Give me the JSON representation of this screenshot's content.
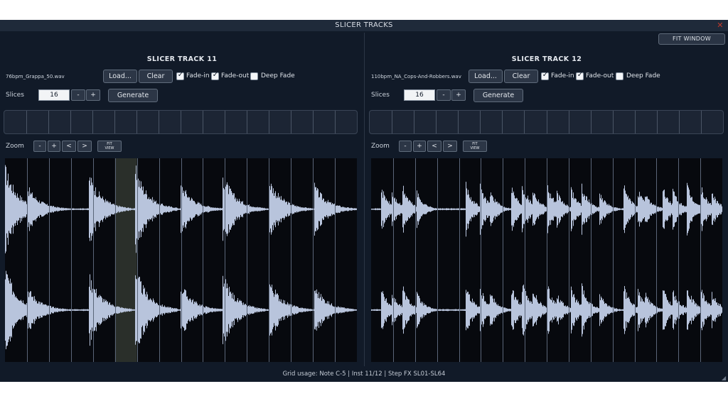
{
  "window": {
    "title": "SLICER TRACKS",
    "close_icon": "close-icon"
  },
  "toolbar": {
    "fit_window_label": "FIT WINDOW"
  },
  "tracks": [
    {
      "title": "SLICER TRACK 11",
      "filename": "76bpm_Grappa_50.wav",
      "load_label": "Load...",
      "clear_label": "Clear",
      "fade_in_label": "Fade-in",
      "fade_in": true,
      "fade_out_label": "Fade-out",
      "fade_out": true,
      "deep_fade_label": "Deep Fade",
      "deep_fade": false,
      "slices_label": "Slices",
      "slices_value": "16",
      "minus_label": "-",
      "plus_label": "+",
      "generate_label": "Generate",
      "zoom_label": "Zoom",
      "zoom_out_label": "-",
      "zoom_in_label": "+",
      "left_label": "<",
      "right_label": ">",
      "fit_view_top": "FIT",
      "fit_view_bottom": "VIEW",
      "slice_count": 16,
      "selected_slice": 5,
      "transients": [
        0.0,
        0.065,
        0.24,
        0.37,
        0.5,
        0.62,
        0.75,
        0.88
      ],
      "transient_heights": [
        0.95,
        0.5,
        0.8,
        0.95,
        0.6,
        0.8,
        0.7,
        0.55
      ]
    },
    {
      "title": "SLICER TRACK 12",
      "filename": "110bpm_NA_Cops-And-Robbers.wav",
      "load_label": "Load...",
      "clear_label": "Clear",
      "fade_in_label": "Fade-in",
      "fade_in": true,
      "fade_out_label": "Fade-out",
      "fade_out": true,
      "deep_fade_label": "Deep Fade",
      "deep_fade": false,
      "slices_label": "Slices",
      "slices_value": "16",
      "minus_label": "-",
      "plus_label": "+",
      "generate_label": "Generate",
      "zoom_label": "Zoom",
      "zoom_out_label": "-",
      "zoom_in_label": "+",
      "left_label": "<",
      "right_label": ">",
      "fit_view_top": "FIT",
      "fit_view_bottom": "VIEW",
      "slice_count": 16,
      "selected_slice": -1,
      "transients": [
        0.03,
        0.06,
        0.09,
        0.13,
        0.27,
        0.31,
        0.34,
        0.4,
        0.43,
        0.46,
        0.5,
        0.53,
        0.57,
        0.6,
        0.65,
        0.72,
        0.76,
        0.78,
        0.83,
        0.86,
        0.9,
        0.94,
        0.97
      ],
      "transient_heights": [
        0.5,
        0.4,
        0.55,
        0.4,
        0.6,
        0.55,
        0.45,
        0.55,
        0.65,
        0.5,
        0.6,
        0.4,
        0.5,
        0.55,
        0.4,
        0.55,
        0.45,
        0.4,
        0.5,
        0.45,
        0.55,
        0.5,
        0.4
      ]
    }
  ],
  "status": "Grid usage: Note C-5 | Inst 11/12 | Step FX SL01-SL64",
  "colors": {
    "background": "#111a28",
    "wave": "#b8c4dc",
    "grid": "#5a6578",
    "selection": "#2a2f2a"
  }
}
